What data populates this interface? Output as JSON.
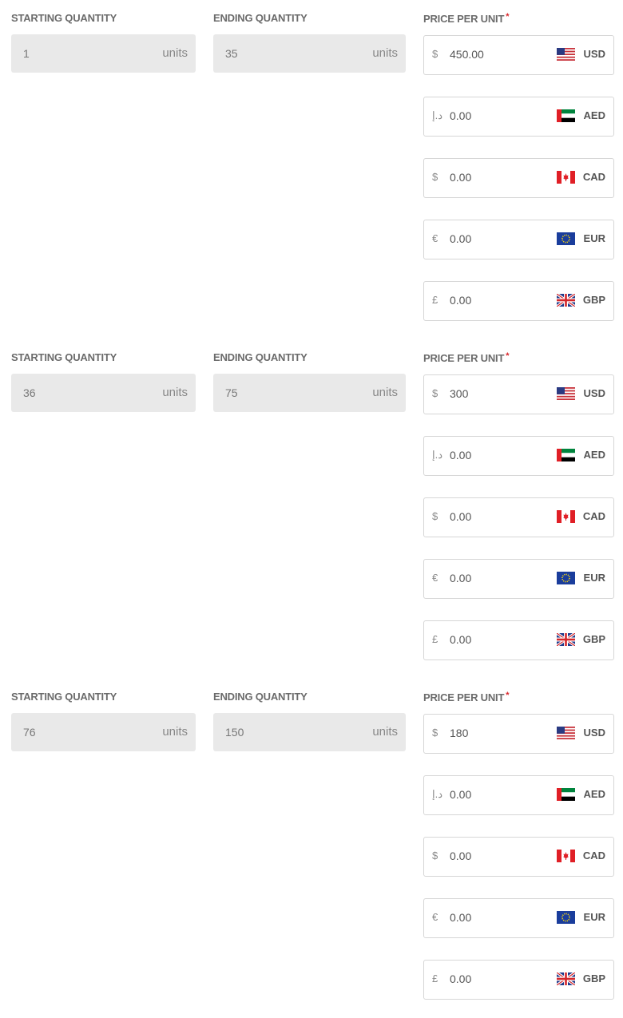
{
  "labels": {
    "starting_quantity": "STARTING QUANTITY",
    "ending_quantity": "ENDING QUANTITY",
    "price_per_unit": "PRICE PER UNIT",
    "required_mark": "*",
    "units": "units"
  },
  "tiers": [
    {
      "start": "1",
      "end": "35",
      "prices": [
        {
          "symbol": "$",
          "value": "450.00",
          "code": "USD",
          "flag": "us-flag-icon"
        },
        {
          "symbol": "د.إ",
          "value": "0.00",
          "code": "AED",
          "flag": "ae-flag-icon"
        },
        {
          "symbol": "$",
          "value": "0.00",
          "code": "CAD",
          "flag": "ca-flag-icon"
        },
        {
          "symbol": "€",
          "value": "0.00",
          "code": "EUR",
          "flag": "eu-flag-icon"
        },
        {
          "symbol": "£",
          "value": "0.00",
          "code": "GBP",
          "flag": "gb-flag-icon"
        }
      ]
    },
    {
      "start": "36",
      "end": "75",
      "prices": [
        {
          "symbol": "$",
          "value": "300",
          "code": "USD",
          "flag": "us-flag-icon"
        },
        {
          "symbol": "د.إ",
          "value": "0.00",
          "code": "AED",
          "flag": "ae-flag-icon"
        },
        {
          "symbol": "$",
          "value": "0.00",
          "code": "CAD",
          "flag": "ca-flag-icon"
        },
        {
          "symbol": "€",
          "value": "0.00",
          "code": "EUR",
          "flag": "eu-flag-icon"
        },
        {
          "symbol": "£",
          "value": "0.00",
          "code": "GBP",
          "flag": "gb-flag-icon"
        }
      ]
    },
    {
      "start": "76",
      "end": "150",
      "prices": [
        {
          "symbol": "$",
          "value": "180",
          "code": "USD",
          "flag": "us-flag-icon"
        },
        {
          "symbol": "د.إ",
          "value": "0.00",
          "code": "AED",
          "flag": "ae-flag-icon"
        },
        {
          "symbol": "$",
          "value": "0.00",
          "code": "CAD",
          "flag": "ca-flag-icon"
        },
        {
          "symbol": "€",
          "value": "0.00",
          "code": "EUR",
          "flag": "eu-flag-icon"
        },
        {
          "symbol": "£",
          "value": "0.00",
          "code": "GBP",
          "flag": "gb-flag-icon"
        }
      ]
    }
  ],
  "colors": {
    "required": "#d9262b",
    "disabled_field_bg": "#e9e9e9",
    "input_border": "#d6d6d6"
  }
}
